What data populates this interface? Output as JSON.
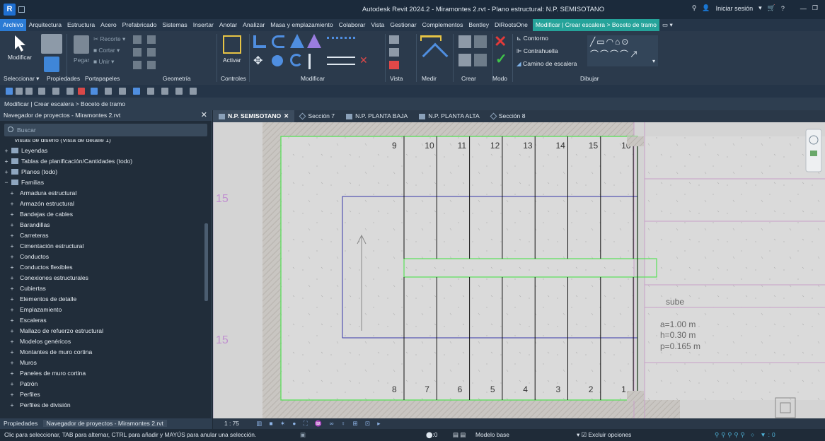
{
  "window": {
    "title": "Autodesk Revit 2024.2 - Miramontes 2.rvt - Plano estructural: N.P. SEMISOTANO",
    "signin": "Iniciar sesión",
    "logo_letter": "R"
  },
  "menu": {
    "items": [
      "Archivo",
      "Arquitectura",
      "Estructura",
      "Acero",
      "Prefabricado",
      "Sistemas",
      "Insertar",
      "Anotar",
      "Analizar",
      "Masa y emplazamiento",
      "Colaborar",
      "Vista",
      "Gestionar",
      "Complementos",
      "Bentley",
      "DiRootsOne"
    ],
    "context_tab": "Modificar | Crear escalera > Boceto de tramo"
  },
  "ribbon": {
    "modify_label": "Modificar",
    "paste_label": "Pegar",
    "activate_label": "Activar",
    "clipboard_items": [
      "Recorte",
      "Cortar",
      "Unir"
    ],
    "draw_items": [
      "Contorno",
      "Contrahuella",
      "Camino de escalera"
    ],
    "panels": [
      "Seleccionar",
      "Propiedades",
      "Portapapeles",
      "Geometría",
      "Controles",
      "Modificar",
      "Vista",
      "Medir",
      "Crear",
      "Modo",
      "Dibujar"
    ]
  },
  "options_bar": {
    "text": "Modificar | Crear escalera > Boceto de tramo"
  },
  "project_browser": {
    "title": "Navegador de proyectos - Miramontes 2.rvt",
    "search_placeholder": "Buscar",
    "items": [
      {
        "label": "Vistas de diseño (Vista de detalle 1)",
        "level": 0,
        "toggle": "",
        "icon": "none"
      },
      {
        "label": "Leyendas",
        "level": 0,
        "toggle": "+",
        "icon": "legend"
      },
      {
        "label": "Tablas de planificación/Cantidades (todo)",
        "level": 0,
        "toggle": "+",
        "icon": "table"
      },
      {
        "label": "Planos (todo)",
        "level": 0,
        "toggle": "+",
        "icon": "sheet"
      },
      {
        "label": "Familias",
        "level": 0,
        "toggle": "−",
        "icon": "family"
      },
      {
        "label": "Armadura estructural",
        "level": 1,
        "toggle": "+",
        "icon": "none"
      },
      {
        "label": "Armazón estructural",
        "level": 1,
        "toggle": "+",
        "icon": "none"
      },
      {
        "label": "Bandejas de cables",
        "level": 1,
        "toggle": "+",
        "icon": "none"
      },
      {
        "label": "Barandillas",
        "level": 1,
        "toggle": "+",
        "icon": "none"
      },
      {
        "label": "Carreteras",
        "level": 1,
        "toggle": "+",
        "icon": "none"
      },
      {
        "label": "Cimentación estructural",
        "level": 1,
        "toggle": "+",
        "icon": "none"
      },
      {
        "label": "Conductos",
        "level": 1,
        "toggle": "+",
        "icon": "none"
      },
      {
        "label": "Conductos flexibles",
        "level": 1,
        "toggle": "+",
        "icon": "none"
      },
      {
        "label": "Conexiones estructurales",
        "level": 1,
        "toggle": "+",
        "icon": "none"
      },
      {
        "label": "Cubiertas",
        "level": 1,
        "toggle": "+",
        "icon": "none"
      },
      {
        "label": "Elementos de detalle",
        "level": 1,
        "toggle": "+",
        "icon": "none"
      },
      {
        "label": "Emplazamiento",
        "level": 1,
        "toggle": "+",
        "icon": "none"
      },
      {
        "label": "Escaleras",
        "level": 1,
        "toggle": "+",
        "icon": "none"
      },
      {
        "label": "Mallazo de refuerzo estructural",
        "level": 1,
        "toggle": "+",
        "icon": "none"
      },
      {
        "label": "Modelos genéricos",
        "level": 1,
        "toggle": "+",
        "icon": "none"
      },
      {
        "label": "Montantes de muro cortina",
        "level": 1,
        "toggle": "+",
        "icon": "none"
      },
      {
        "label": "Muros",
        "level": 1,
        "toggle": "+",
        "icon": "none"
      },
      {
        "label": "Paneles de muro cortina",
        "level": 1,
        "toggle": "+",
        "icon": "none"
      },
      {
        "label": "Patrón",
        "level": 1,
        "toggle": "+",
        "icon": "none"
      },
      {
        "label": "Perfiles",
        "level": 1,
        "toggle": "+",
        "icon": "none"
      },
      {
        "label": "Perfiles de división",
        "level": 1,
        "toggle": "+",
        "icon": "none"
      }
    ],
    "bottom_tabs": [
      "Propiedades",
      "Navegador de proyectos - Miramontes 2.rvt"
    ]
  },
  "view_tabs": [
    {
      "label": "N.P. SEMISOTANO",
      "active": true,
      "icon": "plan"
    },
    {
      "label": "Sección 7",
      "active": false,
      "icon": "section"
    },
    {
      "label": "N.P. PLANTA BAJA",
      "active": false,
      "icon": "plan"
    },
    {
      "label": "N.P. PLANTA ALTA",
      "active": false,
      "icon": "plan"
    },
    {
      "label": "Sección 8",
      "active": false,
      "icon": "section"
    }
  ],
  "drawing": {
    "riser_numbers_top": [
      "9",
      "10",
      "11",
      "12",
      "13",
      "14",
      "15",
      "16"
    ],
    "riser_numbers_bottom": [
      "8",
      "7",
      "6",
      "5",
      "4",
      "3",
      "2",
      "1"
    ],
    "side_marks": [
      "15",
      "15"
    ],
    "note_direction": "sube",
    "note_lines": [
      "a=1.00 m",
      "h=0.30 m",
      "p=0.165 m"
    ]
  },
  "view_control": {
    "scale": "1 : 75"
  },
  "status": {
    "hint": "Clic para seleccionar, TAB para alternar, CTRL para añadir y MAYÚS para anular una selección.",
    "workset_count": ":0",
    "model": "Modelo base",
    "exclude": "Excluir opciones",
    "filter_count": ":0"
  }
}
